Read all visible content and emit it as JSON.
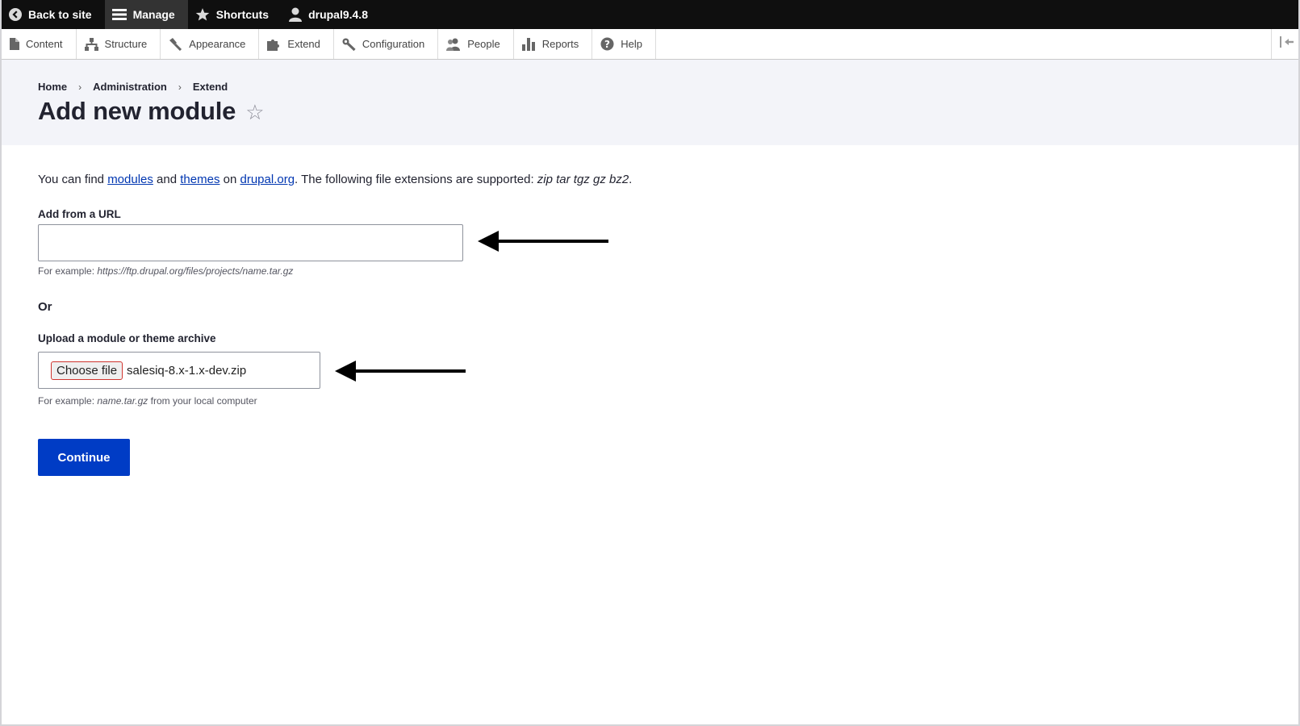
{
  "toolbar": {
    "back": {
      "label": "Back to site",
      "icon": "back-arrow-icon"
    },
    "manage": {
      "label": "Manage",
      "icon": "hamburger-icon"
    },
    "shortcuts": {
      "label": "Shortcuts",
      "icon": "star-icon"
    },
    "user": {
      "label": "drupal9.4.8",
      "icon": "user-icon"
    }
  },
  "tray": {
    "items": [
      {
        "label": "Content",
        "icon": "document-icon"
      },
      {
        "label": "Structure",
        "icon": "hierarchy-icon"
      },
      {
        "label": "Appearance",
        "icon": "brush-icon"
      },
      {
        "label": "Extend",
        "icon": "puzzle-icon"
      },
      {
        "label": "Configuration",
        "icon": "wrench-icon"
      },
      {
        "label": "People",
        "icon": "people-icon"
      },
      {
        "label": "Reports",
        "icon": "bar-chart-icon"
      },
      {
        "label": "Help",
        "icon": "help-icon"
      }
    ],
    "toggle_icon": "orientation-toggle-icon"
  },
  "breadcrumb": [
    "Home",
    "Administration",
    "Extend"
  ],
  "breadcrumb_separator": "›",
  "page": {
    "title": "Add new module",
    "shortcut_icon": "star-outline-icon",
    "shortcut_glyph": "☆"
  },
  "intro": {
    "prefix": "You can find ",
    "link_modules": "modules",
    "and": " and ",
    "link_themes": "themes",
    "on": " on ",
    "link_drupal": "drupal.org",
    "suffix": ". The following file extensions are supported: ",
    "extensions": "zip tar tgz gz bz2",
    "end": "."
  },
  "url_field": {
    "label": "Add from a URL",
    "value": "",
    "desc_prefix": "For example: ",
    "desc_example": "https://ftp.drupal.org/files/projects/name.tar.gz"
  },
  "or_label": "Or",
  "upload_field": {
    "label": "Upload a module or theme archive",
    "button": "Choose file",
    "file_name": "salesiq-8.x-1.x-dev.zip",
    "desc_prefix": "For example: ",
    "desc_example": "name.tar.gz",
    "desc_suffix": " from your local computer"
  },
  "continue_button": "Continue",
  "colors": {
    "toolbar_bg": "#0f0f0f",
    "header_bg": "#f3f4f9",
    "link": "#0036b1",
    "primary_button": "#003cc5"
  }
}
